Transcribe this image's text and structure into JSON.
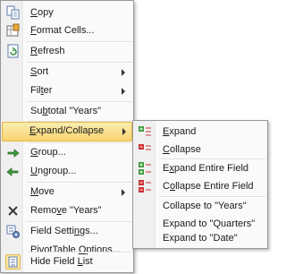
{
  "main_menu": {
    "items": [
      {
        "name": "copy",
        "pre": "",
        "key": "C",
        "post": "opy",
        "icon": "copy-icon",
        "submenu": false
      },
      {
        "name": "format-cells",
        "pre": "",
        "key": "F",
        "post": "ormat Cells...",
        "icon": "format-cells-icon",
        "submenu": false
      },
      {
        "name": "refresh",
        "pre": "",
        "key": "R",
        "post": "efresh",
        "icon": "refresh-icon",
        "submenu": false
      },
      {
        "name": "sort",
        "pre": "",
        "key": "S",
        "post": "ort",
        "icon": "",
        "submenu": true
      },
      {
        "name": "filter",
        "pre": "Fil",
        "key": "t",
        "post": "er",
        "icon": "",
        "submenu": true
      },
      {
        "name": "subtotal-years",
        "pre": "Su",
        "key": "b",
        "post": "total \"Years\"",
        "icon": "",
        "submenu": false
      },
      {
        "name": "expand-collapse",
        "pre": "",
        "key": "E",
        "post": "xpand/Collapse",
        "icon": "",
        "submenu": true,
        "highlighted": true
      },
      {
        "name": "group",
        "pre": "",
        "key": "G",
        "post": "roup...",
        "icon": "group-icon",
        "submenu": false
      },
      {
        "name": "ungroup",
        "pre": "",
        "key": "U",
        "post": "ngroup...",
        "icon": "ungroup-icon",
        "submenu": false
      },
      {
        "name": "move",
        "pre": "",
        "key": "M",
        "post": "ove",
        "icon": "",
        "submenu": true
      },
      {
        "name": "remove-years",
        "pre": "Remo",
        "key": "v",
        "post": "e \"Years\"",
        "icon": "remove-icon",
        "submenu": false
      },
      {
        "name": "field-settings",
        "pre": "Field Setti",
        "key": "n",
        "post": "gs...",
        "icon": "field-settings-icon",
        "submenu": false
      },
      {
        "name": "pivottable-options",
        "pre": "PivotTable ",
        "key": "O",
        "post": "ptions...",
        "icon": "",
        "submenu": false
      },
      {
        "name": "hide-field-list",
        "pre": "Hide Field ",
        "key": "L",
        "post": "ist",
        "icon": "field-list-icon",
        "submenu": false
      }
    ]
  },
  "sub_menu": {
    "items": [
      {
        "name": "expand",
        "pre": "",
        "key": "E",
        "post": "xpand",
        "icon": "expand-icon"
      },
      {
        "name": "collapse",
        "pre": "",
        "key": "C",
        "post": "ollapse",
        "icon": "collapse-icon"
      },
      {
        "name": "expand-entire-field",
        "pre": "E",
        "key": "x",
        "post": "pand Entire Field",
        "icon": "expand-entire-field-icon"
      },
      {
        "name": "collapse-entire-field",
        "pre": "C",
        "key": "o",
        "post": "llapse Entire Field",
        "icon": "collapse-entire-field-icon"
      },
      {
        "name": "collapse-to-years",
        "pre": "",
        "key": "",
        "post": "Collapse to \"Years\"",
        "icon": ""
      },
      {
        "name": "expand-to-quarters",
        "pre": "",
        "key": "",
        "post": "Expand to \"Quarters\"",
        "icon": ""
      },
      {
        "name": "expand-to-date",
        "pre": "",
        "key": "",
        "post": "Expand to \"Date\"",
        "icon": ""
      }
    ]
  },
  "colors": {
    "highlight_top": "#fbedb0",
    "highlight_bottom": "#f8d471",
    "highlight_border": "#e5b743",
    "menu_bg": "#fafafa",
    "border": "#979797"
  }
}
